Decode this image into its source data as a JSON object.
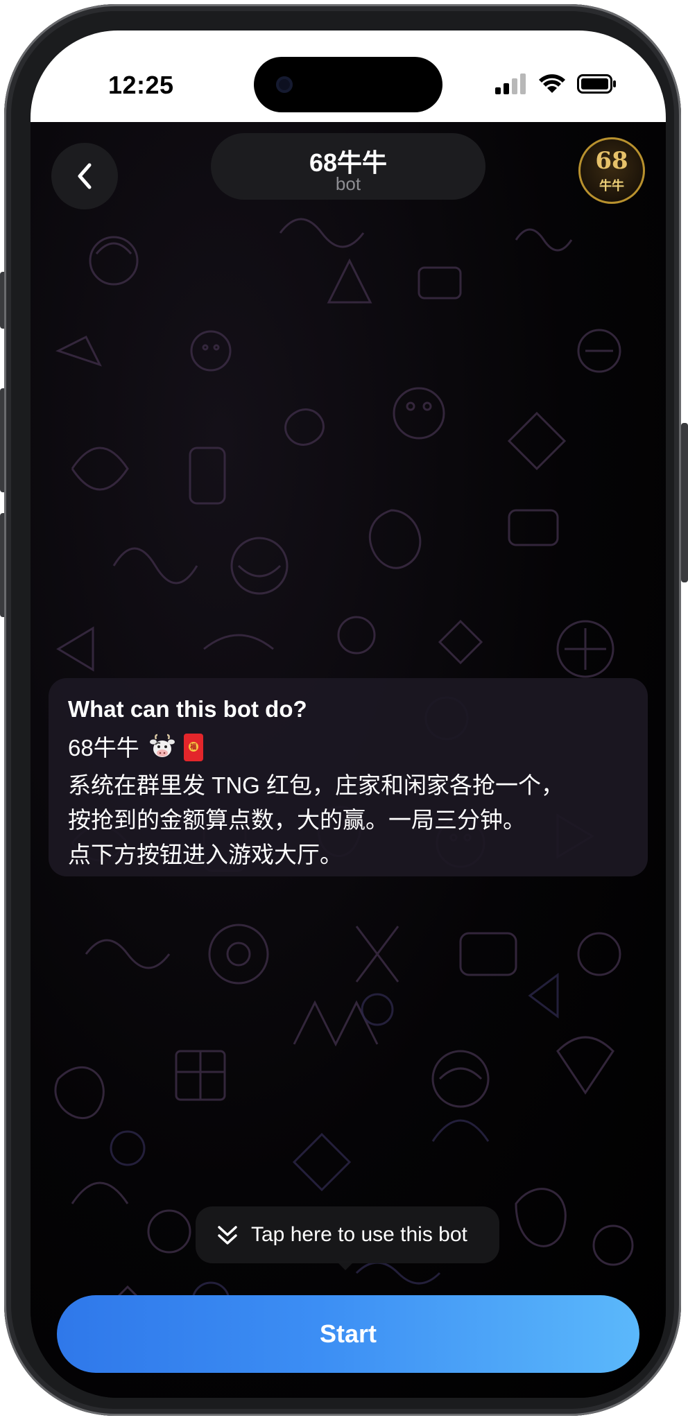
{
  "status_bar": {
    "time": "12:25",
    "icons": [
      "cellular-signal-icon",
      "wifi-icon",
      "battery-icon"
    ]
  },
  "header": {
    "back_icon": "chevron-left-icon",
    "title": "68牛牛",
    "subtitle": "bot",
    "avatar": {
      "number": "68",
      "text": "牛牛"
    }
  },
  "bot_description": {
    "heading": "What can this bot do?",
    "name_line": "68牛牛",
    "emojis": [
      "cow-face",
      "red-envelope"
    ],
    "lines": [
      "系统在群里发 TNG 红包，庄家和闲家各抢一个，",
      "按抢到的金额算点数，大的赢。一局三分钟。",
      "点下方按钮进入游戏大厅。"
    ]
  },
  "hint": {
    "icon": "double-chevron-down-icon",
    "text": "Tap here to use this bot"
  },
  "start_button": {
    "label": "Start"
  },
  "colors": {
    "accent": "#3c8ef4",
    "background": "#000000",
    "bubble": "#1c1822"
  }
}
